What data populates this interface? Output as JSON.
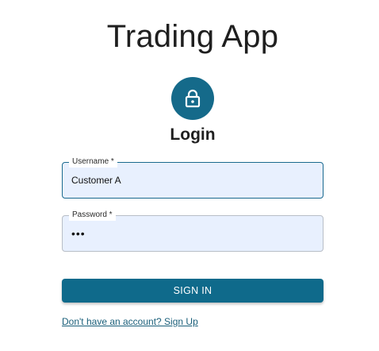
{
  "app": {
    "title": "Trading App"
  },
  "login": {
    "heading": "Login",
    "lock_icon": "lock-icon",
    "accent_color": "#156a8a"
  },
  "form": {
    "username": {
      "label": "Username *",
      "value": "Customer A"
    },
    "password": {
      "label": "Password *",
      "value": "•••"
    },
    "submit_label": "SIGN IN",
    "signup_link": "Don't have an account? Sign Up"
  }
}
